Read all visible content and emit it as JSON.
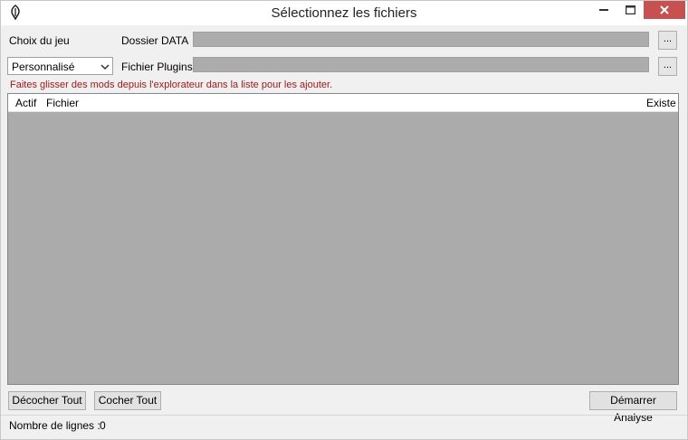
{
  "window": {
    "title": "Sélectionnez les fichiers",
    "app_icon": "quill-pen-icon",
    "controls": {
      "minimize": "minimize-icon",
      "maximize": "maximize-icon",
      "close": "close-icon"
    }
  },
  "game": {
    "label": "Choix du jeu",
    "selected": "Personnalisé"
  },
  "data_folder": {
    "label": "Dossier DATA",
    "value": "",
    "browse_label": "..."
  },
  "plugins_file": {
    "label": "Fichier Plugins",
    "value": "",
    "browse_label": "..."
  },
  "hint": "Faites glisser des mods depuis l'explorateur dans la liste pour les ajouter.",
  "mod_list": {
    "columns": {
      "active": "Actif",
      "file": "Fichier",
      "exists": "Existe"
    },
    "rows": []
  },
  "buttons": {
    "uncheck_all": "Décocher Tout",
    "check_all": "Cocher Tout",
    "start_analysis": "Démarrer Analyse"
  },
  "status": {
    "line_count_label": "Nombre de lignes :",
    "line_count": "0"
  },
  "colors": {
    "close_button": "#c75050",
    "hint_text": "#a01818",
    "list_background": "#ababab"
  }
}
